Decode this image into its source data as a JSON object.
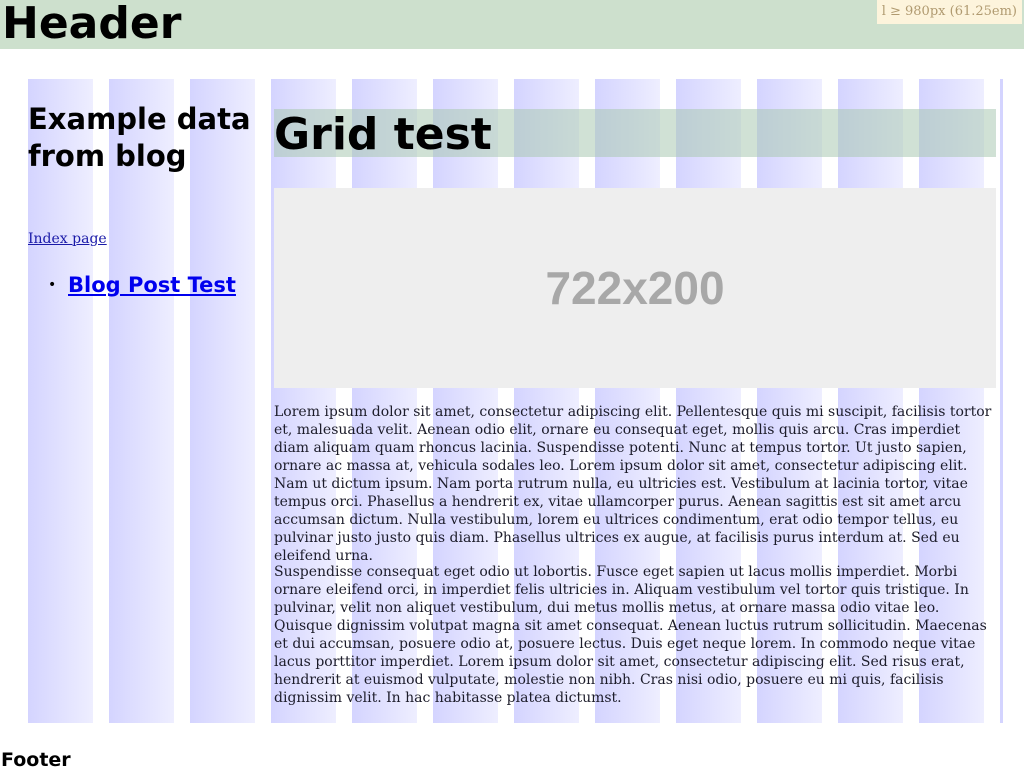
{
  "header": {
    "title": "Header",
    "breakpoint_label": "l ≥ 980px (61.25em)"
  },
  "sidebar": {
    "title": "Example data from blog",
    "index_link": "Index page",
    "posts": [
      {
        "label": "Blog Post Test"
      }
    ]
  },
  "main": {
    "title": "Grid test",
    "image_placeholder": "722x200",
    "paragraphs": [
      "Lorem ipsum dolor sit amet, consectetur adipiscing elit. Pellentesque quis mi suscipit, facilisis tortor et, malesuada velit. Aenean odio elit, ornare eu consequat eget, mollis quis arcu. Cras imperdiet diam aliquam quam rhoncus lacinia. Suspendisse potenti. Nunc at tempus tortor. Ut justo sapien, ornare ac massa at, vehicula sodales leo. Lorem ipsum dolor sit amet, consectetur adipiscing elit. Nam ut dictum ipsum. Nam porta rutrum nulla, eu ultricies est. Vestibulum at lacinia tortor, vitae tempus orci. Phasellus a hendrerit ex, vitae ullamcorper purus. Aenean sagittis est sit amet arcu accumsan dictum. Nulla vestibulum, lorem eu ultrices condimentum, erat odio tempor tellus, eu pulvinar justo justo quis diam. Phasellus ultrices ex augue, at facilisis purus interdum at. Sed eu eleifend urna.",
      "Suspendisse consequat eget odio ut lobortis. Fusce eget sapien ut lacus mollis imperdiet. Morbi ornare eleifend orci, in imperdiet felis ultricies in. Aliquam vestibulum vel tortor quis tristique. In pulvinar, velit non aliquet vestibulum, dui metus mollis metus, at ornare massa odio vitae leo. Quisque dignissim volutpat magna sit amet consequat. Aenean luctus rutrum sollicitudin. Maecenas et dui accumsan, posuere odio at, posuere lectus. Duis eget neque lorem. In commodo neque vitae lacus porttitor imperdiet. Lorem ipsum dolor sit amet, consectetur adipiscing elit. Sed risus erat, hendrerit at euismod vulputate, molestie non nibh. Cras nisi odio, posuere eu mi quis, facilisis dignissim velit. In hac habitasse platea dictumst."
    ]
  },
  "footer": {
    "title": "Footer"
  },
  "colors": {
    "header_bg": "#cde0cd",
    "grid_column": "#d4d4ff",
    "link": "#0000ee",
    "placeholder_bg": "#eeeeee"
  }
}
